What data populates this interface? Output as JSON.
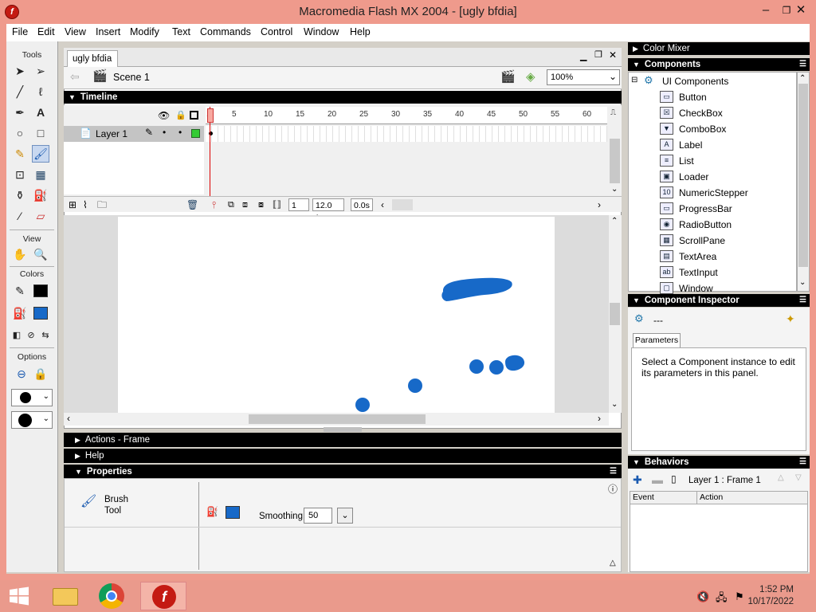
{
  "window": {
    "title": "Macromedia Flash MX 2004 - [ugly bfdia]",
    "app_icon": "flash-icon",
    "min": "–",
    "max": "❐",
    "close": "✕"
  },
  "menubar": [
    "File",
    "Edit",
    "View",
    "Insert",
    "Modify",
    "Text",
    "Commands",
    "Control",
    "Window",
    "Help"
  ],
  "tools": {
    "label": "Tools",
    "view_label": "View",
    "colors_label": "Colors",
    "options_label": "Options",
    "stroke_color": "#000000",
    "fill_color": "#1769c8"
  },
  "document": {
    "tab": "ugly bfdia",
    "scene": "Scene 1",
    "zoom": "100%"
  },
  "timeline": {
    "title": "Timeline",
    "layer": "Layer 1",
    "ruler": [
      "1",
      "5",
      "10",
      "15",
      "20",
      "25",
      "30",
      "35",
      "40",
      "45",
      "50",
      "55",
      "60"
    ],
    "current_frame": "1",
    "fps": "12.0 fps",
    "time": "0.0s"
  },
  "panels": {
    "actions": "Actions - Frame",
    "help": "Help",
    "properties": "Properties"
  },
  "properties": {
    "tool_name": "Brush",
    "tool_sub": "Tool",
    "smoothing_label": "Smoothing",
    "smoothing_value": "50",
    "fill_color": "#1769c8"
  },
  "right": {
    "color_mixer": "Color Mixer",
    "components": "Components",
    "component_inspector": "Component Inspector",
    "behaviors": "Behaviors",
    "ui_components": "UI Components",
    "component_list": [
      "Button",
      "CheckBox",
      "ComboBox",
      "Label",
      "List",
      "Loader",
      "NumericStepper",
      "ProgressBar",
      "RadioButton",
      "ScrollPane",
      "TextArea",
      "TextInput",
      "Window"
    ],
    "ci_placeholder": "---",
    "ci_tab": "Parameters",
    "ci_message": "Select a Component instance to edit its parameters in this panel.",
    "behaviors_frame": "Layer 1 : Frame 1",
    "behaviors_cols": [
      "Event",
      "Action"
    ]
  },
  "taskbar": {
    "time": "1:52 PM",
    "date": "10/17/2022"
  }
}
